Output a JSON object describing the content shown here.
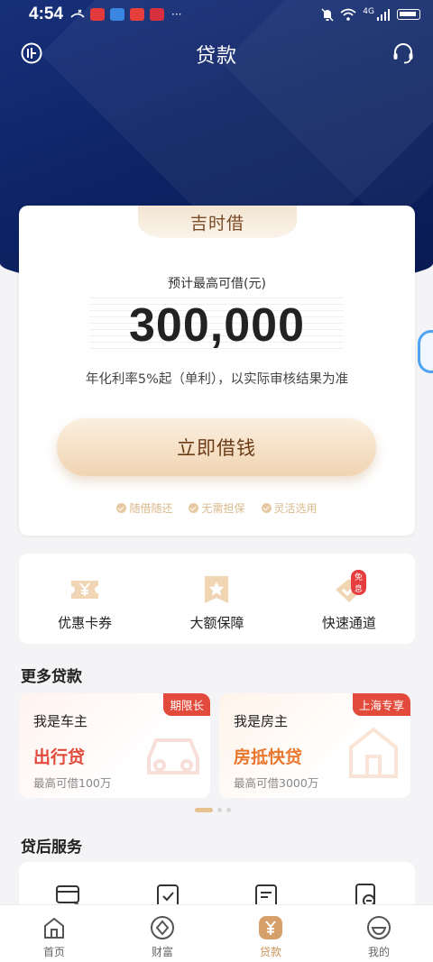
{
  "status_bar": {
    "time": "4:54",
    "signal_text": "4G",
    "more": "···"
  },
  "header": {
    "title": "贷款"
  },
  "loan_card": {
    "tab_label": "吉时借",
    "amount_caption": "预计最高可借(元)",
    "amount": "300,000",
    "rate_note": "年化利率5%起（单利），以实际审核结果为准",
    "cta_label": "立即借钱",
    "features": [
      "随借随还",
      "无需担保",
      "灵活选用"
    ]
  },
  "quick_links": [
    {
      "label": "优惠卡券",
      "icon": "coupon-icon"
    },
    {
      "label": "大额保障",
      "icon": "star-shield-icon"
    },
    {
      "label": "快速通道",
      "icon": "fast-channel-icon",
      "badge": "免息"
    }
  ],
  "more_loans": {
    "title": "更多贷款",
    "items": [
      {
        "who": "我是车主",
        "product": "出行贷",
        "limit": "最高可借100万",
        "badge": "期限长",
        "accent": "#e24a3c"
      },
      {
        "who": "我是房主",
        "product": "房抵快贷",
        "limit": "最高可借3000万",
        "badge": "上海专享",
        "accent": "#e8782f"
      }
    ]
  },
  "after_loan": {
    "title": "贷后服务"
  },
  "tab_bar": [
    {
      "label": "首页",
      "icon": "home-icon"
    },
    {
      "label": "财富",
      "icon": "wealth-icon"
    },
    {
      "label": "贷款",
      "icon": "yuan-icon",
      "active": true
    },
    {
      "label": "我的",
      "icon": "profile-icon"
    }
  ],
  "colors": {
    "hero": "#0e2466",
    "gold": "#c9935b",
    "accent_red": "#e24a3c"
  }
}
